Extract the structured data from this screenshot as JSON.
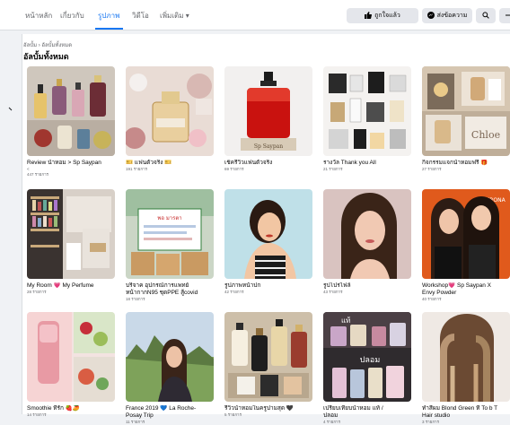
{
  "tabs": [
    {
      "label": "หน้าหลัก"
    },
    {
      "label": "เกี่ยวกับ"
    },
    {
      "label": "รูปภาพ"
    },
    {
      "label": "วิดีโอ"
    },
    {
      "label": "เพิ่มเติม ▾"
    }
  ],
  "actions": {
    "liked_label": "ถูกใจแล้ว",
    "message_label": "ส่งข้อความ",
    "search_icon": "search-icon",
    "more_icon": "more-icon"
  },
  "breadcrumb": "อัลบั้ม › อัลบั้มทั้งหมด",
  "heading": "อัลบั้มทั้งหมด",
  "albums": [
    {
      "title": "Review น้ำหอม > Sp Saypan",
      "sub": "<",
      "count": "447 รายการ"
    },
    {
      "title": "🎫 แฟนตัวจริง 🎫",
      "count": "191 รายการ"
    },
    {
      "title": "เช็ครีวิวแฟนตัวจริง",
      "count": "69 รายการ"
    },
    {
      "title": "รางวัล Thank you All",
      "count": "21 รายการ"
    },
    {
      "title": "กิจกรรมแจกน้ำหอมฟรี 🎁",
      "count": "27 รายการ"
    },
    {
      "title": "My Room 💗 My Perfume",
      "count": "28 รายการ"
    },
    {
      "title": "บริจาค อุปกรณ์การแพทย์",
      "sub": "หน้ากากN95 ชุดPPE สู้covid",
      "count": "18 รายการ"
    },
    {
      "title": "รูปภาพหน้าปก",
      "count": "42 รายการ"
    },
    {
      "title": "รูปโปรไฟล์",
      "count": "43 รายการ"
    },
    {
      "title": "Workshop💗 Sp Saypan X",
      "sub": "Envy Powder",
      "count": "40 รายการ"
    },
    {
      "title": "Smoothie ที่รัก 🍓🥭",
      "count": "14 รายการ"
    },
    {
      "title": "France 2019 💙 La Roche-",
      "sub": "Posay Trip",
      "count": "11 รายการ"
    },
    {
      "title": "รีวิวน้ำหอมในครูปามสุด 🖤",
      "count": "5 รายการ"
    },
    {
      "title": "เปรียบเทียบน้ำหอม แท้ /",
      "sub": "ปลอม",
      "count": "4 รายการ"
    },
    {
      "title": "ทำสีผม Blond Green ที่ To b T",
      "sub": "Hair studio",
      "count": "3 รายการ"
    }
  ],
  "thumb_text": {
    "perfume_bottle": "Sp Saypan",
    "chloe": "Chloe",
    "donation": "พอ มารตา",
    "workshop_brand": "VERONA",
    "fake_real": "ปลอม",
    "fake_real_top": "แท้"
  },
  "colors": {
    "accent": "#1877f2",
    "topbar_bg": "#ffffff",
    "page_bg": "#f0f2f5",
    "secondary_text": "#65676b"
  }
}
